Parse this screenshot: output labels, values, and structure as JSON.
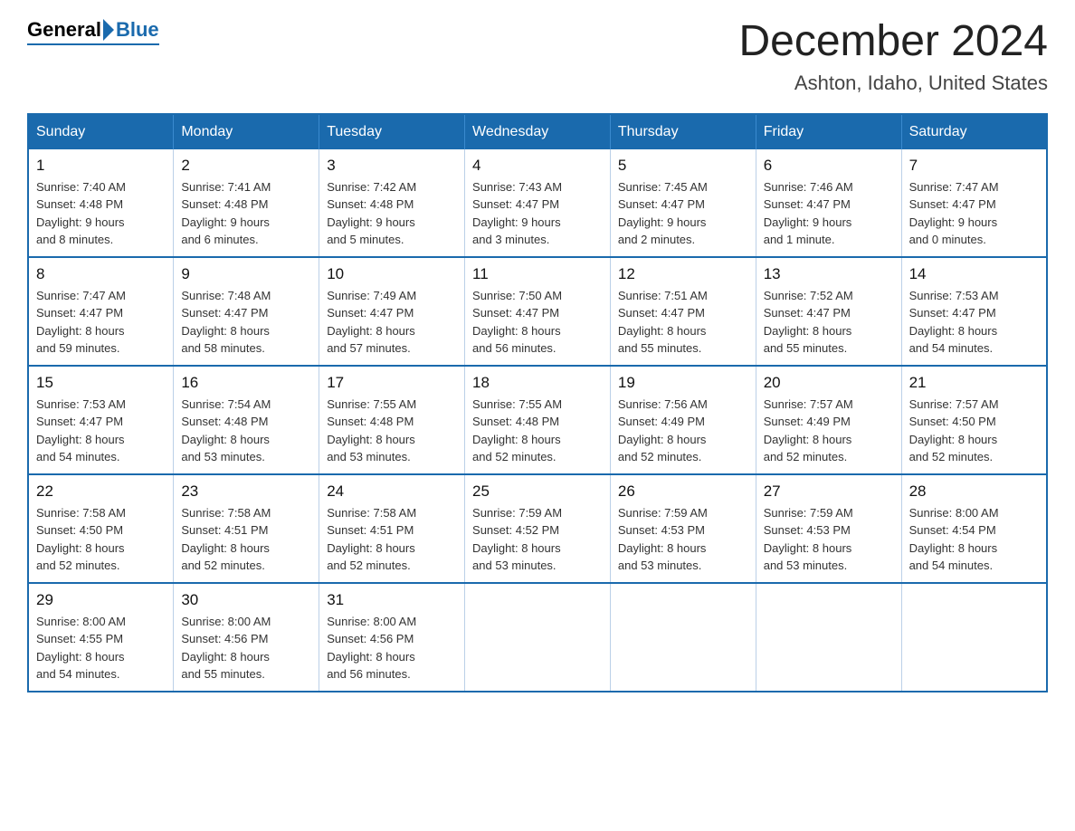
{
  "header": {
    "logo_general": "General",
    "logo_blue": "Blue",
    "month_title": "December 2024",
    "location": "Ashton, Idaho, United States"
  },
  "weekdays": [
    "Sunday",
    "Monday",
    "Tuesday",
    "Wednesday",
    "Thursday",
    "Friday",
    "Saturday"
  ],
  "weeks": [
    [
      {
        "day": "1",
        "sunrise": "7:40 AM",
        "sunset": "4:48 PM",
        "daylight": "9 hours and 8 minutes."
      },
      {
        "day": "2",
        "sunrise": "7:41 AM",
        "sunset": "4:48 PM",
        "daylight": "9 hours and 6 minutes."
      },
      {
        "day": "3",
        "sunrise": "7:42 AM",
        "sunset": "4:48 PM",
        "daylight": "9 hours and 5 minutes."
      },
      {
        "day": "4",
        "sunrise": "7:43 AM",
        "sunset": "4:47 PM",
        "daylight": "9 hours and 3 minutes."
      },
      {
        "day": "5",
        "sunrise": "7:45 AM",
        "sunset": "4:47 PM",
        "daylight": "9 hours and 2 minutes."
      },
      {
        "day": "6",
        "sunrise": "7:46 AM",
        "sunset": "4:47 PM",
        "daylight": "9 hours and 1 minute."
      },
      {
        "day": "7",
        "sunrise": "7:47 AM",
        "sunset": "4:47 PM",
        "daylight": "9 hours and 0 minutes."
      }
    ],
    [
      {
        "day": "8",
        "sunrise": "7:47 AM",
        "sunset": "4:47 PM",
        "daylight": "8 hours and 59 minutes."
      },
      {
        "day": "9",
        "sunrise": "7:48 AM",
        "sunset": "4:47 PM",
        "daylight": "8 hours and 58 minutes."
      },
      {
        "day": "10",
        "sunrise": "7:49 AM",
        "sunset": "4:47 PM",
        "daylight": "8 hours and 57 minutes."
      },
      {
        "day": "11",
        "sunrise": "7:50 AM",
        "sunset": "4:47 PM",
        "daylight": "8 hours and 56 minutes."
      },
      {
        "day": "12",
        "sunrise": "7:51 AM",
        "sunset": "4:47 PM",
        "daylight": "8 hours and 55 minutes."
      },
      {
        "day": "13",
        "sunrise": "7:52 AM",
        "sunset": "4:47 PM",
        "daylight": "8 hours and 55 minutes."
      },
      {
        "day": "14",
        "sunrise": "7:53 AM",
        "sunset": "4:47 PM",
        "daylight": "8 hours and 54 minutes."
      }
    ],
    [
      {
        "day": "15",
        "sunrise": "7:53 AM",
        "sunset": "4:47 PM",
        "daylight": "8 hours and 54 minutes."
      },
      {
        "day": "16",
        "sunrise": "7:54 AM",
        "sunset": "4:48 PM",
        "daylight": "8 hours and 53 minutes."
      },
      {
        "day": "17",
        "sunrise": "7:55 AM",
        "sunset": "4:48 PM",
        "daylight": "8 hours and 53 minutes."
      },
      {
        "day": "18",
        "sunrise": "7:55 AM",
        "sunset": "4:48 PM",
        "daylight": "8 hours and 52 minutes."
      },
      {
        "day": "19",
        "sunrise": "7:56 AM",
        "sunset": "4:49 PM",
        "daylight": "8 hours and 52 minutes."
      },
      {
        "day": "20",
        "sunrise": "7:57 AM",
        "sunset": "4:49 PM",
        "daylight": "8 hours and 52 minutes."
      },
      {
        "day": "21",
        "sunrise": "7:57 AM",
        "sunset": "4:50 PM",
        "daylight": "8 hours and 52 minutes."
      }
    ],
    [
      {
        "day": "22",
        "sunrise": "7:58 AM",
        "sunset": "4:50 PM",
        "daylight": "8 hours and 52 minutes."
      },
      {
        "day": "23",
        "sunrise": "7:58 AM",
        "sunset": "4:51 PM",
        "daylight": "8 hours and 52 minutes."
      },
      {
        "day": "24",
        "sunrise": "7:58 AM",
        "sunset": "4:51 PM",
        "daylight": "8 hours and 52 minutes."
      },
      {
        "day": "25",
        "sunrise": "7:59 AM",
        "sunset": "4:52 PM",
        "daylight": "8 hours and 53 minutes."
      },
      {
        "day": "26",
        "sunrise": "7:59 AM",
        "sunset": "4:53 PM",
        "daylight": "8 hours and 53 minutes."
      },
      {
        "day": "27",
        "sunrise": "7:59 AM",
        "sunset": "4:53 PM",
        "daylight": "8 hours and 53 minutes."
      },
      {
        "day": "28",
        "sunrise": "8:00 AM",
        "sunset": "4:54 PM",
        "daylight": "8 hours and 54 minutes."
      }
    ],
    [
      {
        "day": "29",
        "sunrise": "8:00 AM",
        "sunset": "4:55 PM",
        "daylight": "8 hours and 54 minutes."
      },
      {
        "day": "30",
        "sunrise": "8:00 AM",
        "sunset": "4:56 PM",
        "daylight": "8 hours and 55 minutes."
      },
      {
        "day": "31",
        "sunrise": "8:00 AM",
        "sunset": "4:56 PM",
        "daylight": "8 hours and 56 minutes."
      },
      null,
      null,
      null,
      null
    ]
  ],
  "labels": {
    "sunrise": "Sunrise: ",
    "sunset": "Sunset: ",
    "daylight": "Daylight: "
  }
}
